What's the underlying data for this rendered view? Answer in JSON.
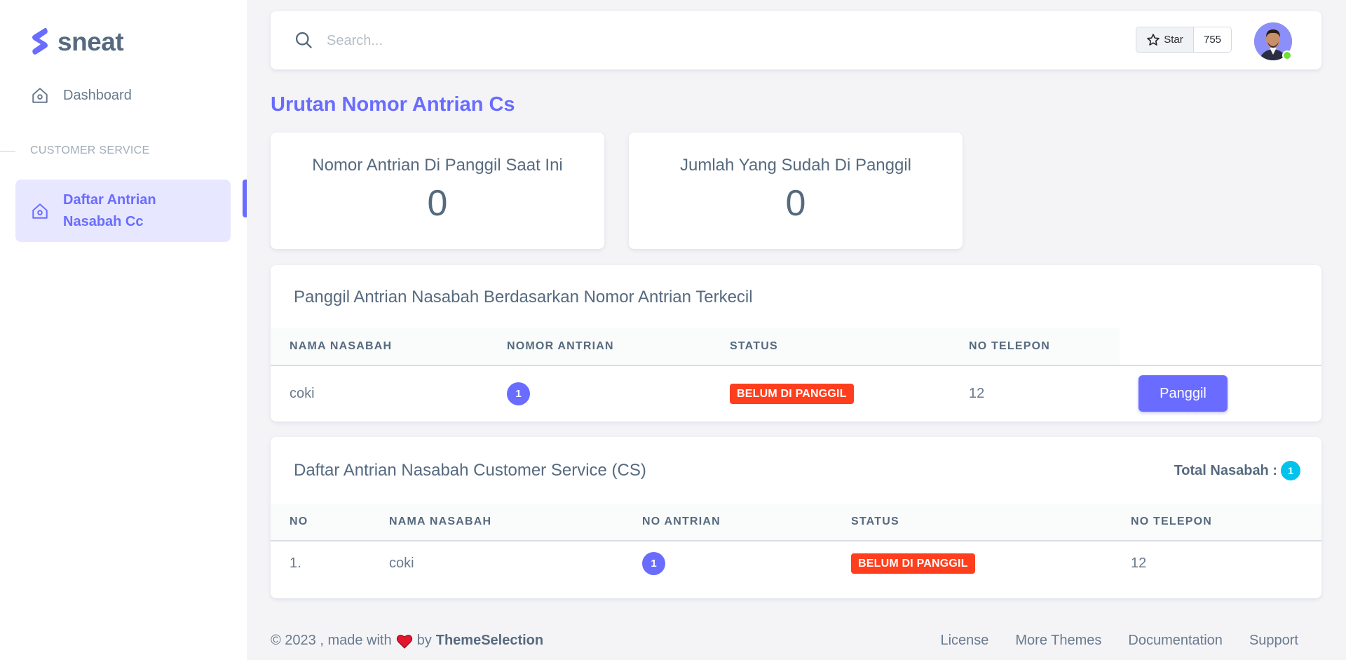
{
  "brand": {
    "name": "sneat",
    "logo_icon": "sneat-logo-icon",
    "accent": "#696cff"
  },
  "sidebar": {
    "dashboard_label": "Dashboard",
    "section_header": "CUSTOMER SERVICE",
    "active_item_label_line1": "Daftar Antrian",
    "active_item_label_line2": "Nasabah Cc"
  },
  "navbar": {
    "search_placeholder": "Search...",
    "star_label": "Star",
    "star_count": "755"
  },
  "page": {
    "title": "Urutan Nomor Antrian Cs"
  },
  "stats": [
    {
      "label": "Nomor Antrian Di Panggil Saat Ini",
      "value": "0"
    },
    {
      "label": "Jumlah Yang Sudah Di Panggil",
      "value": "0"
    }
  ],
  "call_table": {
    "title": "Panggil Antrian Nasabah Berdasarkan Nomor Antrian Terkecil",
    "headers": [
      "NAMA NASABAH",
      "NOMOR ANTRIAN",
      "STATUS",
      "NO TELEPON"
    ],
    "row": {
      "name": "coki",
      "number": "1",
      "status": "BELUM DI PANGGIL",
      "phone": "12"
    },
    "button_label": "Panggil"
  },
  "queue_table": {
    "title": "Daftar Antrian Nasabah Customer Service (CS)",
    "total_label": "Total Nasabah :",
    "total_count": "1",
    "headers": [
      "NO",
      "NAMA NASABAH",
      "NO ANTRIAN",
      "STATUS",
      "NO TELEPON"
    ],
    "rows": [
      {
        "no": "1.",
        "name": "coki",
        "number": "1",
        "status": "BELUM DI PANGGIL",
        "phone": "12"
      }
    ]
  },
  "footer": {
    "copyright": "© 2023 , made with",
    "by": "by",
    "brand": "ThemeSelection",
    "links": [
      "License",
      "More Themes",
      "Documentation",
      "Support"
    ]
  },
  "colors": {
    "primary": "#696cff",
    "danger": "#ff3e1d",
    "info": "#03c3ec",
    "success": "#71dd37"
  }
}
